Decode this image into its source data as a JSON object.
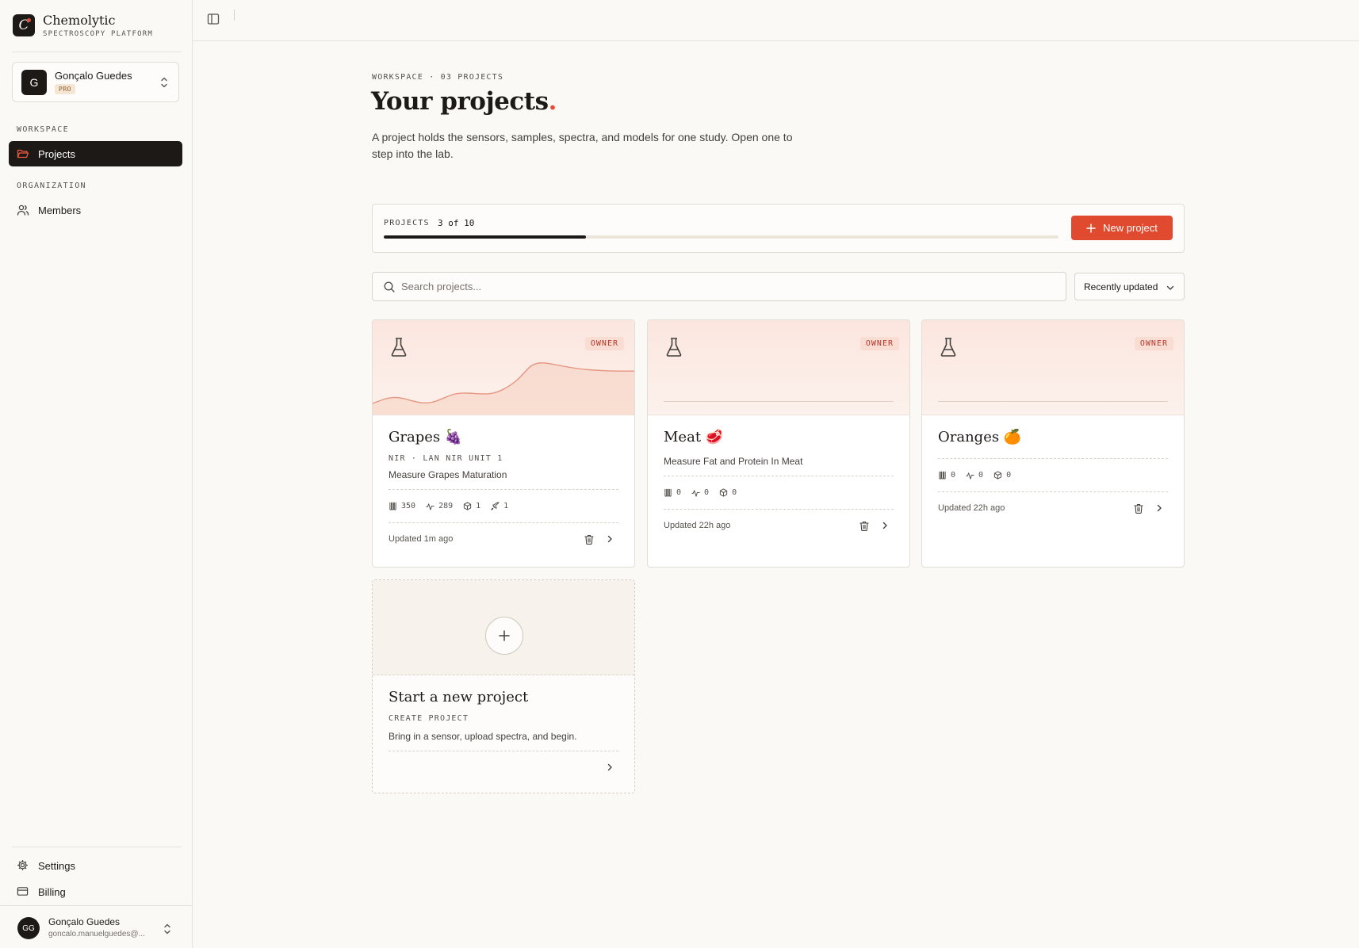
{
  "brand": {
    "name": "Chemolytic",
    "subtitle": "SPECTROSCOPY PLATFORM"
  },
  "account": {
    "initial": "G",
    "name": "Gonçalo Guedes",
    "plan": "PRO"
  },
  "sidebar": {
    "sections": [
      {
        "label": "WORKSPACE",
        "items": [
          {
            "label": "Projects",
            "icon": "folder-open-icon",
            "active": true
          }
        ]
      },
      {
        "label": "ORGANIZATION",
        "items": [
          {
            "label": "Members",
            "icon": "users-icon",
            "active": false
          }
        ]
      }
    ],
    "bottom_items": [
      {
        "label": "Settings",
        "icon": "gear-icon"
      },
      {
        "label": "Billing",
        "icon": "credit-card-icon"
      }
    ]
  },
  "user": {
    "initials": "GG",
    "name": "Gonçalo Guedes",
    "email": "goncalo.manuelguedes@..."
  },
  "header": {
    "eyebrow": "WORKSPACE · 03 PROJECTS",
    "title": "Your projects",
    "title_dot": ".",
    "description": "A project holds the sensors, samples, spectra, and models for one study. Open one to step into the lab."
  },
  "quota": {
    "label": "PROJECTS",
    "count_text": "3 of 10",
    "used": 3,
    "limit": 10,
    "new_button": "New project"
  },
  "search": {
    "placeholder": "Search projects...",
    "value": ""
  },
  "sort": {
    "selected": "Recently updated"
  },
  "colors": {
    "accent": "#e04a2f",
    "dark": "#1c1917",
    "background": "#faf9f6"
  },
  "projects": [
    {
      "name": "Grapes 🍇",
      "role": "OWNER",
      "meta": "NIR · LAN NIR UNIT 1",
      "description": "Measure Grapes Maturation",
      "stats": {
        "samples": "350",
        "spectra": "289",
        "models": "1",
        "deployments": "1"
      },
      "updated": "Updated 1m ago"
    },
    {
      "name": "Meat 🥩",
      "role": "OWNER",
      "description": "Measure Fat and Protein In Meat",
      "stats": {
        "samples": "0",
        "spectra": "0",
        "models": "0"
      },
      "updated": "Updated 22h ago"
    },
    {
      "name": "Oranges 🍊",
      "role": "OWNER",
      "stats": {
        "samples": "0",
        "spectra": "0",
        "models": "0"
      },
      "updated": "Updated 22h ago"
    }
  ],
  "new_project_card": {
    "title": "Start a new project",
    "meta": "CREATE PROJECT",
    "description": "Bring in a sensor, upload spectra, and begin."
  }
}
